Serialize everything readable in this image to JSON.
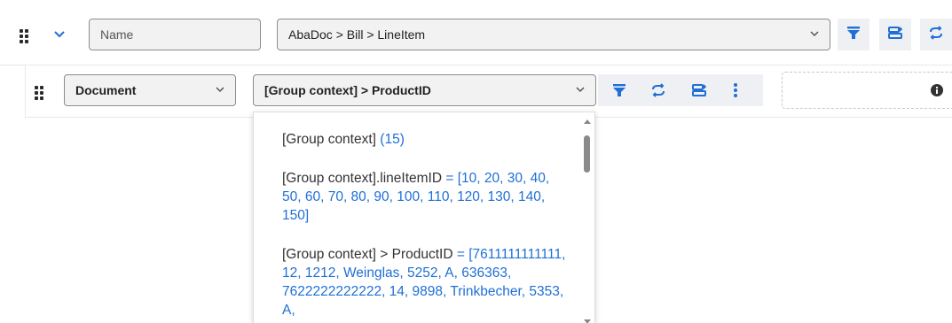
{
  "top_row": {
    "name_field": {
      "value": "Name"
    },
    "path_select": {
      "value": "AbaDoc > Bill > LineItem"
    },
    "icons": [
      "drag-handle-icon",
      "chevron-down-icon",
      "filter-icon",
      "export-icon",
      "swap-icon"
    ]
  },
  "second_row": {
    "document_select": {
      "value": "Document"
    },
    "path_select": {
      "value": "[Group context] > ProductID"
    },
    "icons": [
      "drag-handle-icon",
      "filter-icon",
      "swap-icon",
      "export-icon",
      "more-vertical-icon",
      "info-icon"
    ]
  },
  "dropdown": {
    "options": [
      {
        "label": "[Group context]",
        "value": "(15)"
      },
      {
        "label": "[Group context].lineItemID",
        "value": "= [10, 20, 30, 40, 50, 60, 70, 80, 90, 100, 110, 120, 130, 140, 150]"
      },
      {
        "label": "[Group context] > ProductID",
        "value": "= [7611111111111, 12, 1212, Weinglas, 5252, A, 636363, 7622222222222, 14, 9898, Trinkbecher, 5353, A,"
      }
    ]
  },
  "colors": {
    "accent": "#1f6fd6",
    "field_bg": "#f2f2f2",
    "button_bg": "#eef0f3"
  }
}
